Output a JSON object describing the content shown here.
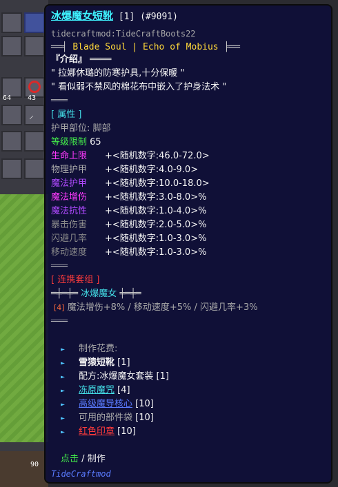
{
  "item": {
    "name": "冰爆魔女短靴",
    "tag": "[1]",
    "id": "(#9091)",
    "internal": "tidecraftmod:TideCraftBoots22",
    "series": "Blade Soul | Echo of Mobius",
    "series_left": "══╡",
    "series_right": "╞══"
  },
  "intro": {
    "header": "『介绍』",
    "header_trail": "════",
    "line1": "\" 拉娜休璐的防寒护具,十分保暖 \"",
    "line2": "\" 看似弱不禁风的棉花布中嵌入了护身法术 \"",
    "sep": "════"
  },
  "attrs": {
    "header": "[ 属性 ]",
    "slot_label": "护甲部位:",
    "slot_value": "脚部",
    "level_label": "等级限制",
    "level_value": "65",
    "rows": [
      {
        "label": "生命上限",
        "value": "+<随机数字:46.0-72.0>"
      },
      {
        "label": "物理护甲",
        "value": "+<随机数字:4.0-9.0>"
      },
      {
        "label": "魔法护甲",
        "value": "+<随机数字:10.0-18.0>"
      },
      {
        "label": "魔法增伤",
        "value": "+<随机数字:3.0-8.0>%"
      },
      {
        "label": "魔法抗性",
        "value": "+<随机数字:1.0-4.0>%"
      },
      {
        "label": "暴击伤害",
        "value": "+<随机数字:2.0-5.0>%"
      },
      {
        "label": "闪避几率",
        "value": "+<随机数字:1.0-3.0>%"
      },
      {
        "label": "移动速度",
        "value": "+<随机数字:1.0-3.0>%"
      }
    ],
    "sep": "════"
  },
  "set": {
    "header": "[ 连携套组 ]",
    "deco_left": "═╪═╪═",
    "name": "冰爆魔女",
    "deco_right": "╪═╪═",
    "bonus_tag": "[4]",
    "bonus_text": "魔法增伤+8% / 移动速度+5% / 闪避几率+3%",
    "sep": "════"
  },
  "craft": {
    "cost_label": "制作花费:",
    "items": [
      {
        "name": "雪猿短靴",
        "qty": "[1]"
      },
      {
        "name": "配方:冰爆魔女套装",
        "qty": "[1]"
      },
      {
        "name": "冻原魔咒",
        "qty": "[4]"
      },
      {
        "name": "高级魔导核心",
        "qty": "[10]"
      },
      {
        "name": "可用的部件袋",
        "qty": "[10]"
      },
      {
        "name": "红色印章",
        "qty": "[10]"
      }
    ],
    "action_click": "点击",
    "action_sep": "/",
    "action_craft": "制作"
  },
  "mod_name": "TideCraftmod",
  "inventory": {
    "count_a": "64",
    "count_b": "43",
    "bottom_count": "90"
  },
  "colors": {
    "panel_bg": "#0f0f37",
    "title": "#3ff3ff",
    "gold": "#ffd83a",
    "attr_header": "#44e0e8",
    "level": "#44f04a",
    "set_header": "#ff3b3b",
    "mod_name": "#5a7bff"
  }
}
